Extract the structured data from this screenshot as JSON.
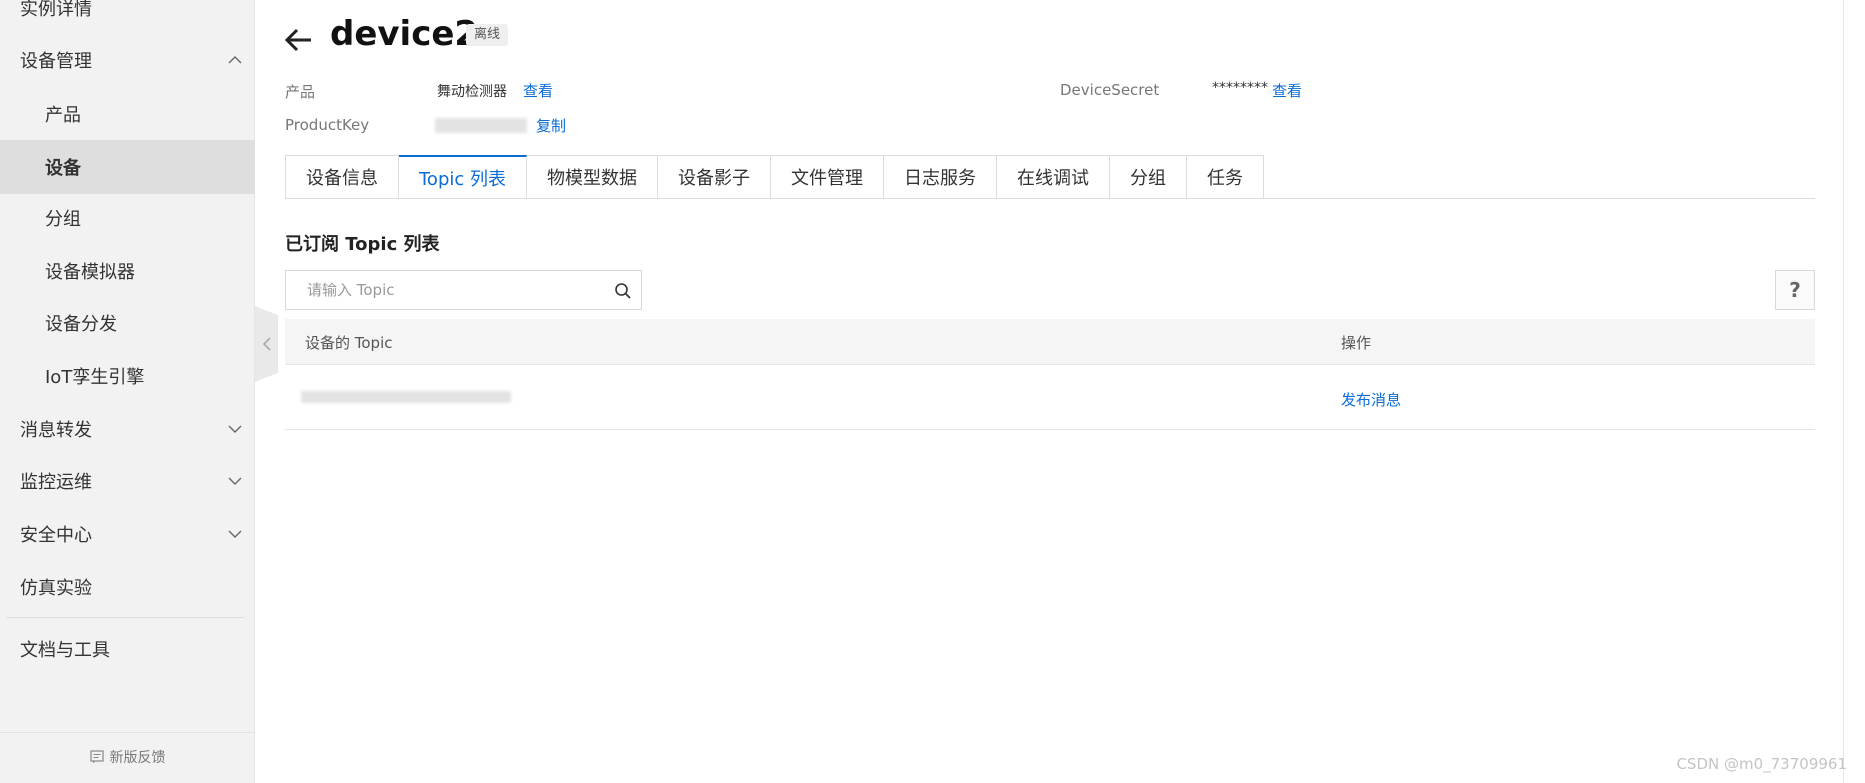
{
  "sidebar": {
    "items": [
      {
        "label": "实例详情",
        "level": "top"
      },
      {
        "label": "设备管理",
        "level": "top",
        "expanded": true
      },
      {
        "label": "产品",
        "level": "sub"
      },
      {
        "label": "设备",
        "level": "sub",
        "active": true
      },
      {
        "label": "分组",
        "level": "sub"
      },
      {
        "label": "设备模拟器",
        "level": "sub"
      },
      {
        "label": "设备分发",
        "level": "sub"
      },
      {
        "label": "IoT孪生引擎",
        "level": "sub"
      },
      {
        "label": "消息转发",
        "level": "top",
        "expanded": false
      },
      {
        "label": "监控运维",
        "level": "top",
        "expanded": false
      },
      {
        "label": "安全中心",
        "level": "top",
        "expanded": false
      },
      {
        "label": "仿真实验",
        "level": "top"
      },
      {
        "label": "文档与工具",
        "level": "top"
      }
    ],
    "feedback_label": "新版反馈"
  },
  "header": {
    "device_name": "device2",
    "status": "离线"
  },
  "info": {
    "product_label": "产品",
    "product_value": "舞动检测器",
    "product_link": "查看",
    "productkey_label": "ProductKey",
    "productkey_link": "复制",
    "secret_label": "DeviceSecret",
    "secret_value": "********",
    "secret_link": "查看"
  },
  "tabs": [
    {
      "label": "设备信息"
    },
    {
      "label": "Topic 列表",
      "active": true
    },
    {
      "label": "物模型数据"
    },
    {
      "label": "设备影子"
    },
    {
      "label": "文件管理"
    },
    {
      "label": "日志服务"
    },
    {
      "label": "在线调试"
    },
    {
      "label": "分组"
    },
    {
      "label": "任务"
    }
  ],
  "section": {
    "title": "已订阅 Topic 列表",
    "search_placeholder": "请输入 Topic",
    "help": "?"
  },
  "table": {
    "col_topic": "设备的 Topic",
    "col_action": "操作",
    "rows": [
      {
        "action": "发布消息"
      }
    ]
  },
  "watermark": "CSDN @m0_73709961",
  "colors": {
    "accent": "#0a6cd6",
    "sidebar_bg": "#f2f2f2",
    "sidebar_active": "#dedede"
  }
}
